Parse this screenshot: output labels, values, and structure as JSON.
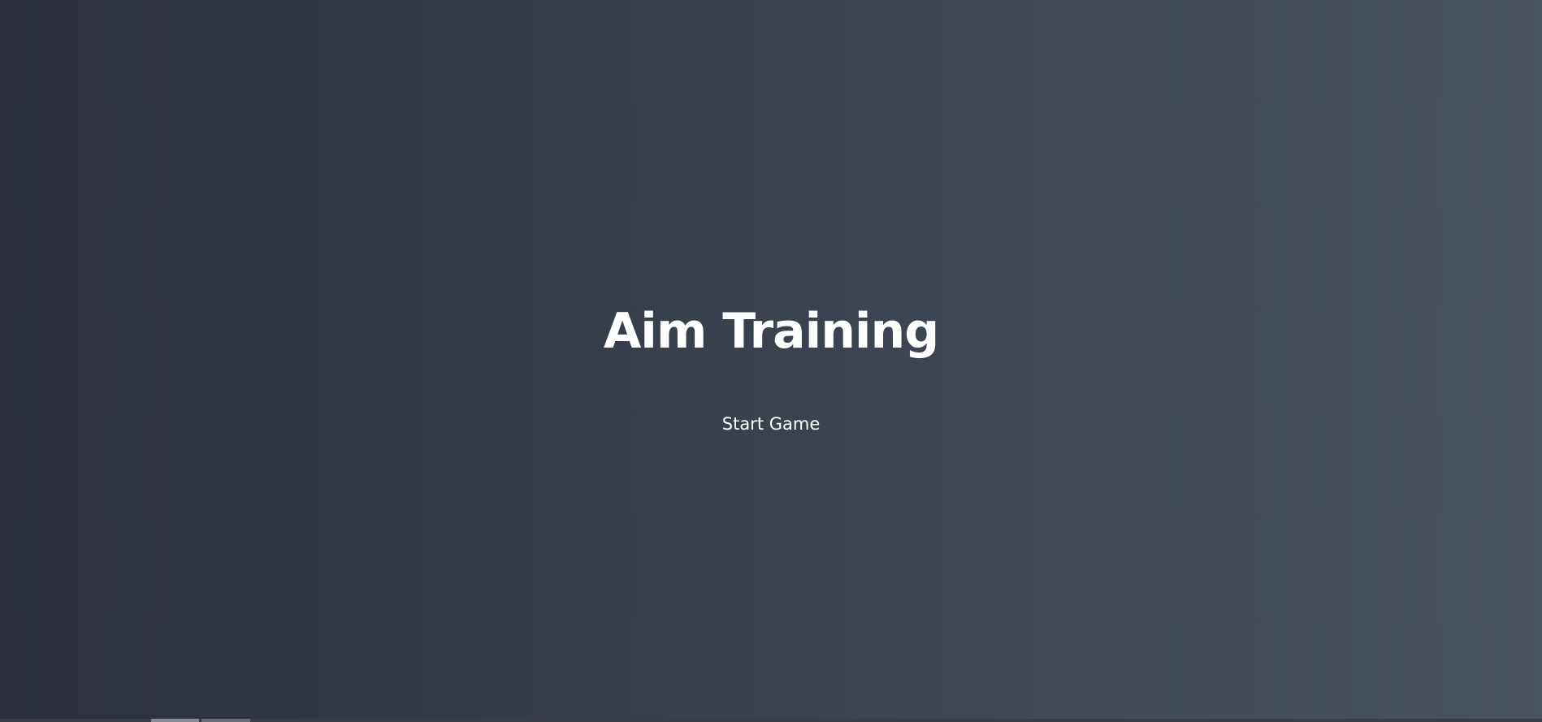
{
  "game": {
    "title": "Aim Training",
    "start_label": "Start Game"
  },
  "colors": {
    "background_left": "#2c313b",
    "background_right": "#4a5360",
    "text": "#ffffff"
  }
}
